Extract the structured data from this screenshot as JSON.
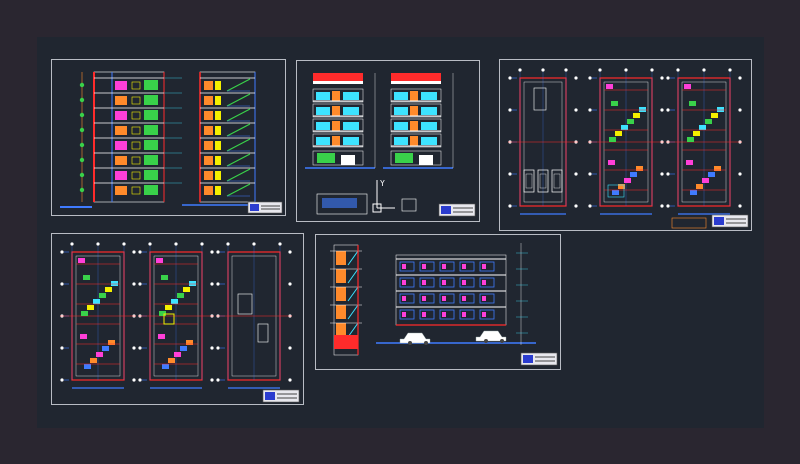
{
  "app": {
    "title": "",
    "background": "#2a2630",
    "canvas_color": "#202630"
  },
  "colors": {
    "frame": "#b8bcc4",
    "wall": "#ff2b2b",
    "dim": "#3f7bff",
    "green": "#39d14a",
    "yellow": "#f4f000",
    "white": "#ffffff",
    "orange": "#ff8a2b",
    "magenta": "#ff3fd8",
    "cyan": "#3de3ff"
  },
  "sheets": [
    {
      "id": "sections",
      "kind": "sections"
    },
    {
      "id": "elevations",
      "kind": "elevations"
    },
    {
      "id": "parking-plans",
      "kind": "plans"
    },
    {
      "id": "floor-plans",
      "kind": "plans"
    },
    {
      "id": "elevation-side",
      "kind": "side"
    }
  ],
  "ucs_icon": {
    "axis_label": "Y"
  }
}
